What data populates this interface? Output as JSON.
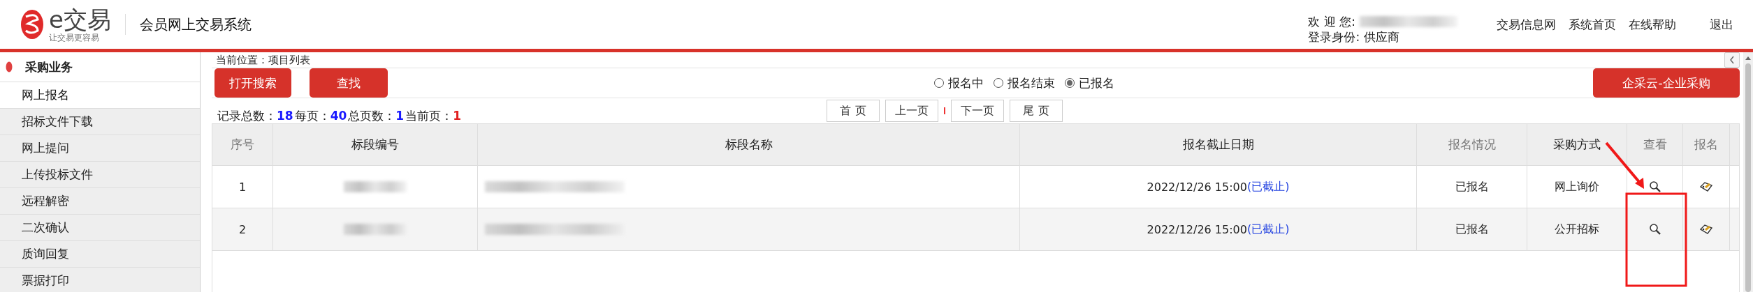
{
  "header": {
    "logo_title": "e交易",
    "logo_slogan": "让交易更容易",
    "system_title": "会员网上交易系统",
    "welcome_label": "欢 迎 您:",
    "role_label": "登录身份:",
    "role": "供应商",
    "links": [
      "交易信息网",
      "系统首页",
      "在线帮助",
      "退出"
    ]
  },
  "sidebar": {
    "title": "采购业务",
    "items": [
      {
        "label": "网上报名",
        "selected": true
      },
      {
        "label": "招标文件下载",
        "selected": false
      },
      {
        "label": "网上提问",
        "selected": false
      },
      {
        "label": "上传投标文件",
        "selected": false
      },
      {
        "label": "远程解密",
        "selected": false
      },
      {
        "label": "二次确认",
        "selected": false
      },
      {
        "label": "质询回复",
        "selected": false
      },
      {
        "label": "票据打印",
        "selected": false
      }
    ]
  },
  "breadcrumb": "当前位置：项目列表",
  "toolbar": {
    "buttons": [
      "打开搜索",
      "查找"
    ],
    "radios": [
      {
        "label": "报名中",
        "selected": false
      },
      {
        "label": "报名结束",
        "selected": false
      },
      {
        "label": "已报名",
        "selected": true
      }
    ],
    "right_button": "企采云-企业采购"
  },
  "stats": [
    {
      "label": "记录总数：",
      "value": "18",
      "color": "#1a1aff"
    },
    {
      "label": "每页：",
      "value": "40",
      "color": "#1a1aff"
    },
    {
      "label": "总页数：",
      "value": "1",
      "color": "#1a1aff"
    },
    {
      "label": "当前页：",
      "value": "1",
      "color": "#e02020"
    }
  ],
  "pager": [
    "首 页",
    "上一页",
    "下一页",
    "尾 页"
  ],
  "table": {
    "columns": [
      {
        "label": "序号",
        "muted": true
      },
      {
        "label": "标段编号",
        "muted": false
      },
      {
        "label": "标段名称",
        "muted": false
      },
      {
        "label": "报名截止日期",
        "muted": false
      },
      {
        "label": "报名情况",
        "muted": true
      },
      {
        "label": "采购方式",
        "muted": false
      },
      {
        "label": "查看",
        "muted": true
      },
      {
        "label": "报名",
        "muted": true
      }
    ],
    "rows": [
      {
        "index": "1",
        "deadline": "2022/12/26 15:00",
        "deadline_status": "(已截止)",
        "signup": "已报名",
        "method": "网上询价"
      },
      {
        "index": "2",
        "deadline": "2022/12/26 15:00",
        "deadline_status": "(已截止)",
        "signup": "已报名",
        "method": "公开招标"
      }
    ]
  }
}
